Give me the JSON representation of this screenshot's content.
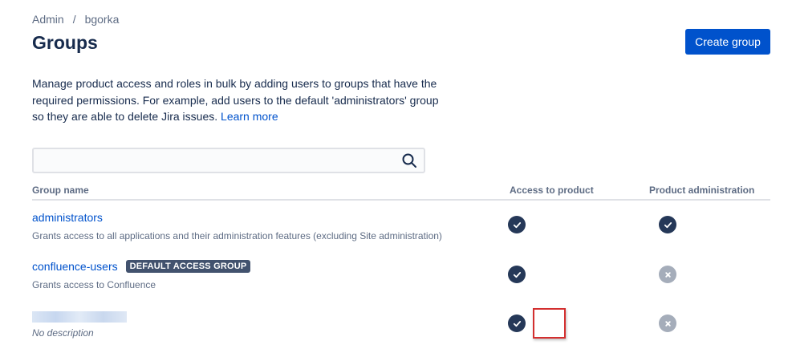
{
  "breadcrumb": {
    "root": "Admin",
    "separator": "/",
    "current": "bgorka"
  },
  "page": {
    "title": "Groups",
    "create_label": "Create group"
  },
  "description": {
    "text": "Manage product access and roles in bulk by adding users to groups that have the required permissions. For example, add users to the default 'administrators' group so they are able to delete Jira issues. ",
    "link": "Learn more"
  },
  "search": {
    "value": "",
    "placeholder": ""
  },
  "table": {
    "headers": {
      "name": "Group name",
      "access": "Access to product",
      "admin": "Product administration"
    },
    "rows": [
      {
        "name": "administrators",
        "description": "Grants access to all applications and their administration features (excluding Site administration)",
        "badge": "",
        "access": true,
        "admin": true
      },
      {
        "name": "confluence-users",
        "description": "Grants access to Confluence",
        "badge": "DEFAULT ACCESS GROUP",
        "access": true,
        "admin": false
      },
      {
        "name": "",
        "description": "No description",
        "badge": "",
        "access": true,
        "admin": false
      }
    ]
  },
  "icons": {
    "search": "search-icon",
    "yes": "check-circle-icon",
    "no": "cross-circle-icon"
  },
  "colors": {
    "primary": "#0052cc",
    "status_yes": "#253858",
    "status_no": "#a5adba",
    "highlight": "#d32f2f"
  }
}
